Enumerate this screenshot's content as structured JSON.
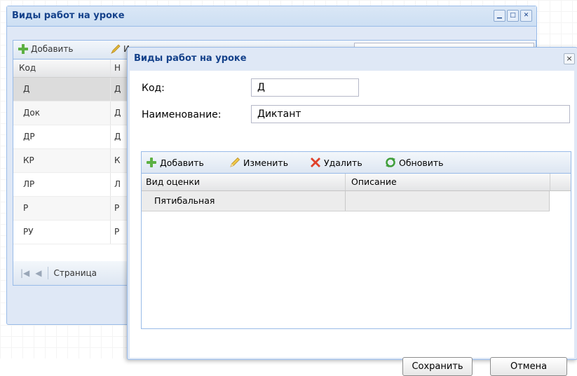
{
  "background_window": {
    "title": "Виды работ на уроке",
    "toolbar": {
      "add_label": "Добавить",
      "edit_label_partial": "И"
    },
    "grid": {
      "columns": [
        "Код",
        "Н"
      ],
      "rows": [
        {
          "code": "Д",
          "name": "Д"
        },
        {
          "code": "Док",
          "name": "Д"
        },
        {
          "code": "ДР",
          "name": "Д"
        },
        {
          "code": "КР",
          "name": "К"
        },
        {
          "code": "ЛР",
          "name": "Л"
        },
        {
          "code": "Р",
          "name": "Р"
        },
        {
          "code": "РУ",
          "name": "Р"
        }
      ]
    },
    "pager": {
      "page_label": "Страница"
    }
  },
  "dialog": {
    "title": "Виды работ на уроке",
    "close_symbol": "×",
    "code_label": "Код:",
    "code_value": "Д",
    "name_label": "Наименование:",
    "name_value": "Диктант",
    "toolbar": {
      "add_label": "Добавить",
      "edit_label": "Изменить",
      "delete_label": "Удалить",
      "refresh_label": "Обновить"
    },
    "grid": {
      "columns": [
        "Вид оценки",
        "Описание"
      ],
      "rows": [
        {
          "grade_type": "Пятибальная",
          "description": ""
        }
      ]
    },
    "save_label": "Сохранить",
    "cancel_label": "Отмена"
  },
  "colors": {
    "title_text": "#15428b",
    "window_bg": "#dfe8f6",
    "border": "#99bbe8",
    "add_icon": "#5cb043",
    "delete_icon": "#e0402a",
    "refresh_icon": "#3f9e3a",
    "edit_icon": "#e0b83a"
  },
  "icons": [
    "plus-icon",
    "pencil-icon",
    "delete-x-icon",
    "refresh-icon"
  ]
}
